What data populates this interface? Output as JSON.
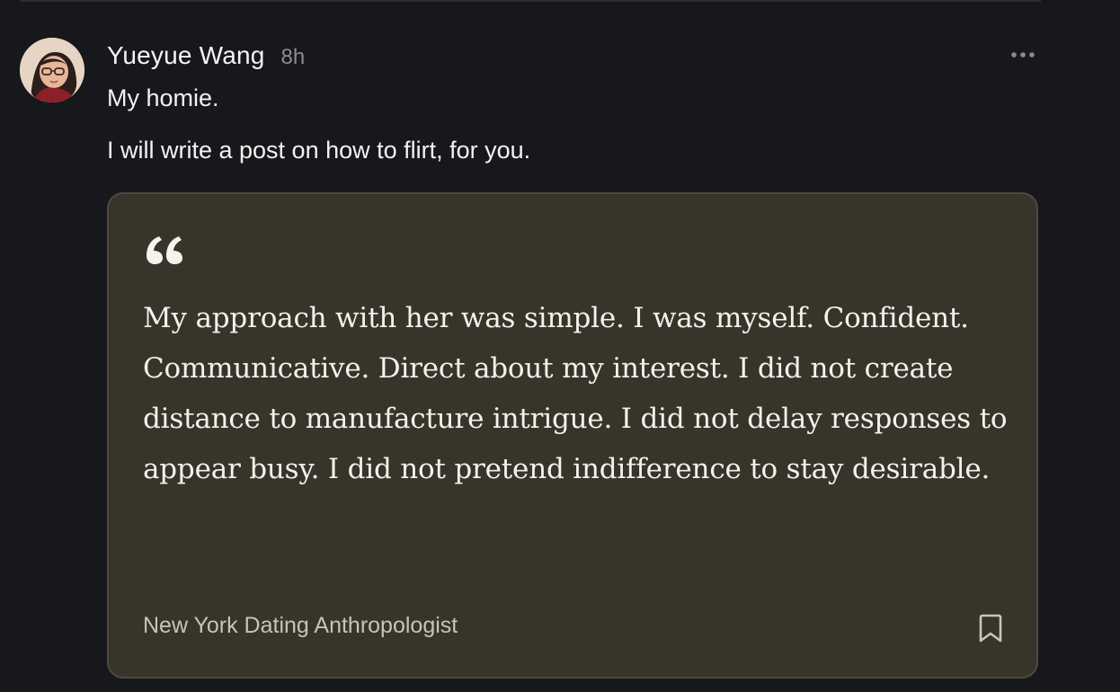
{
  "post": {
    "author": "Yueyue Wang",
    "time": "8h",
    "lines": [
      "My homie.",
      "I will write a post on how to flirt, for you."
    ]
  },
  "quote": {
    "text": "My approach with her was simple. I was myself. Confident. Communicative. Direct about my interest. I did not create distance to manufacture intrigue. I did not delay responses to appear busy. I did not pretend indifference to stay desirable.",
    "source": "New York Dating Anthropologist"
  },
  "icons": {
    "avatar": "avatar",
    "more": "more-icon",
    "quote": "quote-icon",
    "bookmark": "bookmark-icon"
  },
  "colors": {
    "background": "#17181b",
    "card_background": "#38342a",
    "card_border": "#4d4a41",
    "text_primary": "#f2f2f2",
    "text_secondary": "#8d8e92",
    "source_text": "#c7c3b8"
  }
}
